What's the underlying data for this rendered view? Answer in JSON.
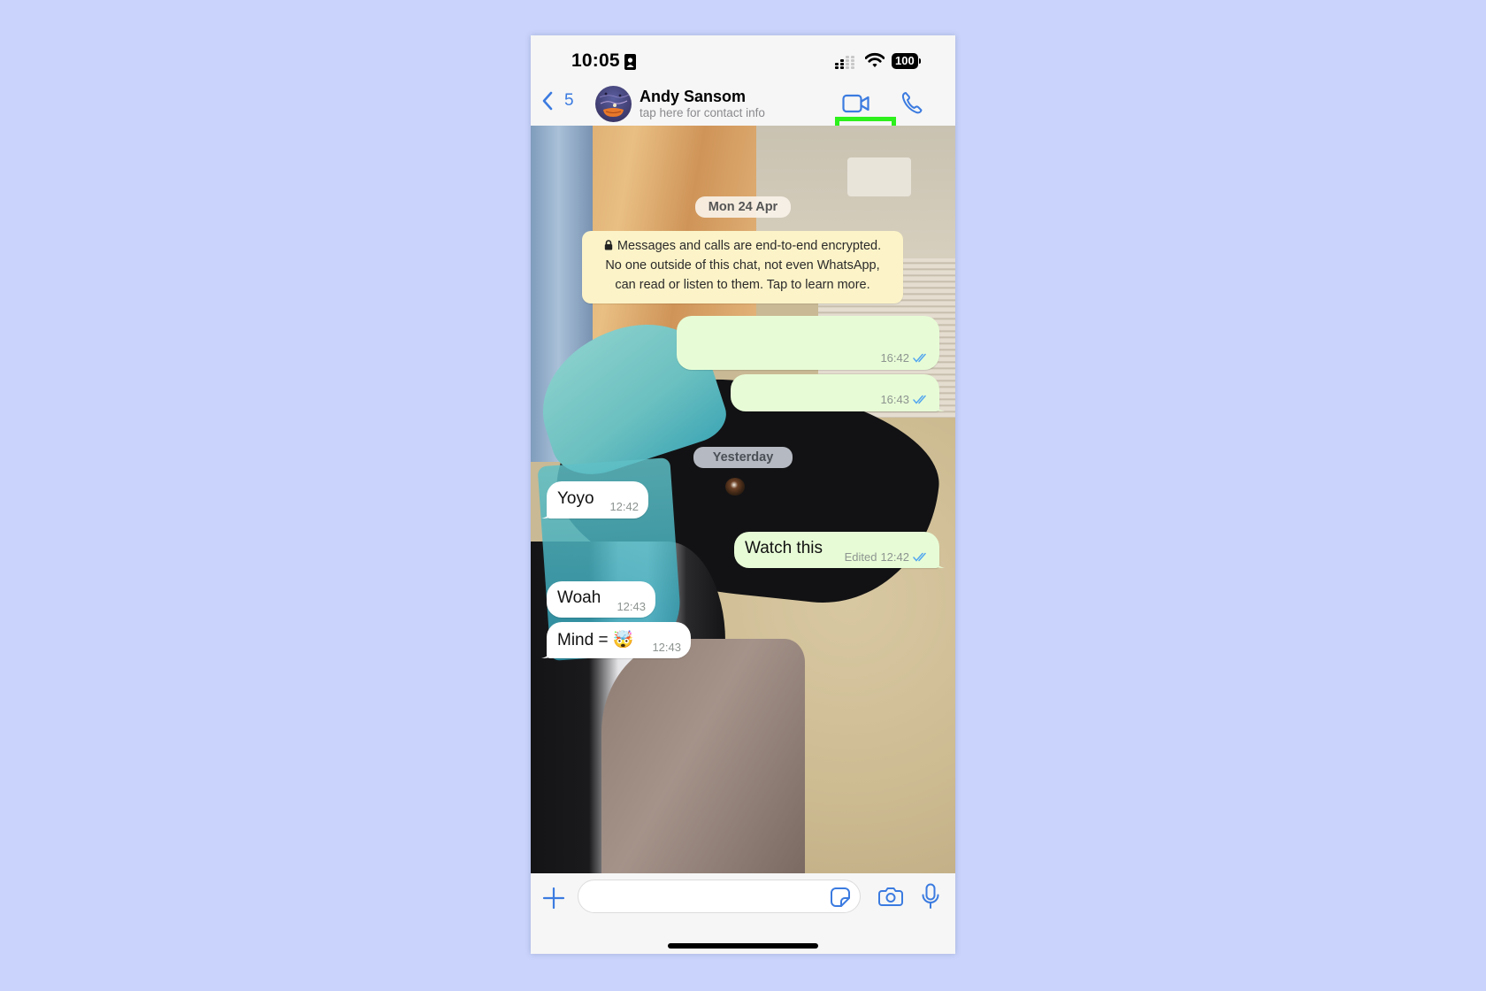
{
  "status_bar": {
    "time": "10:05",
    "battery": "100",
    "icons": [
      "contact-card-icon",
      "signal-icon",
      "wifi-icon",
      "battery-icon"
    ]
  },
  "header": {
    "back_count": "5",
    "contact_name": "Andy Sansom",
    "contact_subtitle": "tap here for contact info",
    "actions": [
      "video-call-icon",
      "voice-call-icon"
    ],
    "highlighted_action": "video-call",
    "highlight_color": "#2df01c"
  },
  "chat": {
    "date_separators": [
      "Mon 24 Apr",
      "Yesterday"
    ],
    "encryption_notice": {
      "icon": "lock-icon",
      "lines": [
        "Messages and calls are end-to-end encrypted.",
        "No one outside of this chat, not even WhatsApp,",
        "can read or listen to them. Tap to learn more."
      ]
    },
    "messages": [
      {
        "direction": "sent",
        "text": "",
        "time": "16:42",
        "status": "read"
      },
      {
        "direction": "sent",
        "text": "",
        "time": "16:43",
        "status": "read"
      },
      {
        "direction": "received",
        "text": "Yoyo",
        "time": "12:42"
      },
      {
        "direction": "sent",
        "text": "Watch this",
        "edited_label": "Edited",
        "time": "12:42",
        "status": "read"
      },
      {
        "direction": "received",
        "text": "Woah",
        "time": "12:43"
      },
      {
        "direction": "received",
        "text": "Mind = 🤯",
        "time": "12:43"
      }
    ]
  },
  "input_bar": {
    "message_value": "",
    "message_placeholder": "",
    "icons": [
      "plus-icon",
      "sticker-icon",
      "camera-icon",
      "microphone-icon"
    ]
  },
  "colors": {
    "accent": "#3b7be0",
    "sent_bubble": "#e7fcd6",
    "received_bubble": "#ffffff",
    "encryption_bg": "#fcf3c8",
    "read_ticks": "#53a6f0",
    "page_background": "#c9d3fb"
  }
}
